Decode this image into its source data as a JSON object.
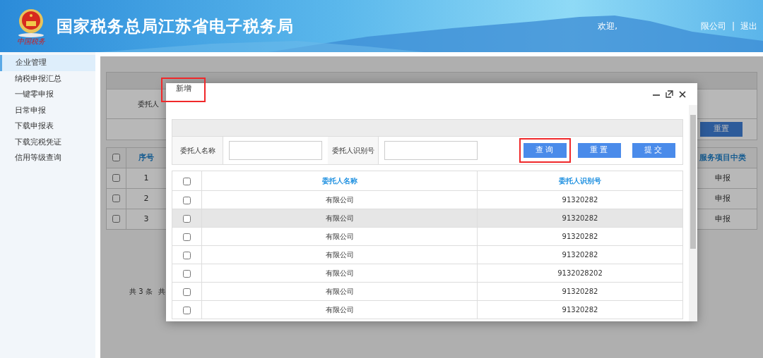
{
  "header": {
    "title": "国家税务总局江苏省电子税务局",
    "logo_text": "中国税务",
    "welcome": "欢迎,",
    "company": "限公司",
    "separator": "|",
    "logout": "退出"
  },
  "sidebar": {
    "items": [
      {
        "label": "企业管理",
        "selected": true
      },
      {
        "label": "纳税申报汇总",
        "selected": false
      },
      {
        "label": "一键零申报",
        "selected": false
      },
      {
        "label": "日常申报",
        "selected": false
      },
      {
        "label": "下载申报表",
        "selected": false
      },
      {
        "label": "下载完税凭证",
        "selected": false
      },
      {
        "label": "信用等级查询",
        "selected": false
      }
    ]
  },
  "background_page": {
    "select_all_checked": false,
    "filter_label": "委托人",
    "reset_button": "重置",
    "columns": [
      "序号",
      "服务项目中类"
    ],
    "rows": [
      {
        "index": "1",
        "category": "申报",
        "checked": false
      },
      {
        "index": "2",
        "category": "申报",
        "checked": false
      },
      {
        "index": "3",
        "category": "申报",
        "checked": false
      }
    ],
    "pagination": "共 3 条",
    "pagination_cut": "共"
  },
  "modal": {
    "title": "新增",
    "title_highlighted": true,
    "select_all_checked": false,
    "filters": [
      {
        "label": "委托人名称"
      },
      {
        "label": "委托人识别号"
      }
    ],
    "buttons": [
      {
        "label": "查询",
        "highlighted": true
      },
      {
        "label": "重置",
        "highlighted": false
      },
      {
        "label": "提交",
        "highlighted": false
      }
    ],
    "columns": [
      "委托人名称",
      "委托人识别号"
    ],
    "rows": [
      {
        "name": "有限公司",
        "id": "91320282",
        "selected": false,
        "checked": false
      },
      {
        "name": "有限公司",
        "id": "91320282",
        "selected": true,
        "checked": false
      },
      {
        "name": "有限公司",
        "id": "91320282",
        "selected": false,
        "checked": false
      },
      {
        "name": "有限公司",
        "id": "91320282",
        "selected": false,
        "checked": false
      },
      {
        "name": "有限公司",
        "id": "9132028202",
        "selected": false,
        "checked": false
      },
      {
        "name": "有限公司",
        "id": "91320282",
        "selected": false,
        "checked": false
      },
      {
        "name": "有限公司",
        "id": "91320282",
        "selected": false,
        "checked": false
      }
    ]
  }
}
